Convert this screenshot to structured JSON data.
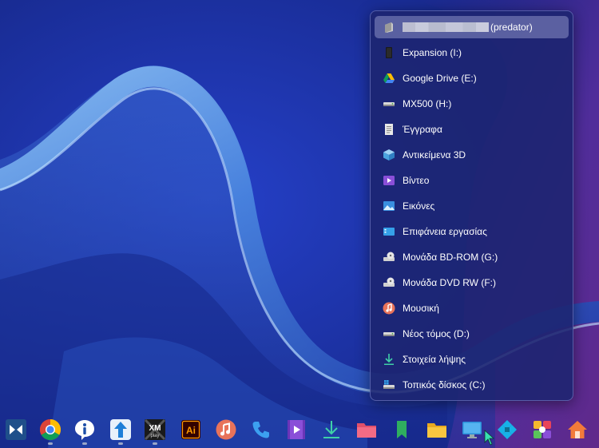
{
  "menu": {
    "items": [
      {
        "label": "(predator)",
        "icon": "user-folder-icon",
        "redacted": true,
        "selected": true
      },
      {
        "label": "Expansion (I:)",
        "icon": "external-drive-icon"
      },
      {
        "label": "Google Drive (E:)",
        "icon": "google-drive-icon"
      },
      {
        "label": "MX500 (H:)",
        "icon": "hard-drive-icon"
      },
      {
        "label": "Έγγραφα",
        "icon": "documents-icon"
      },
      {
        "label": "Αντικείμενα 3D",
        "icon": "3d-objects-icon"
      },
      {
        "label": "Βίντεο",
        "icon": "videos-icon"
      },
      {
        "label": "Εικόνες",
        "icon": "pictures-icon"
      },
      {
        "label": "Επιφάνεια εργασίας",
        "icon": "desktop-icon"
      },
      {
        "label": "Μονάδα BD-ROM (G:)",
        "icon": "optical-drive-icon"
      },
      {
        "label": "Μονάδα DVD RW (F:)",
        "icon": "optical-drive-icon"
      },
      {
        "label": "Μουσική",
        "icon": "music-icon"
      },
      {
        "label": "Νέος τόμος (D:)",
        "icon": "hard-drive-icon"
      },
      {
        "label": "Στοιχεία λήψης",
        "icon": "downloads-icon"
      },
      {
        "label": "Τοπικός δίσκος (C:)",
        "icon": "system-drive-icon"
      }
    ]
  },
  "taskbar": {
    "icons": [
      {
        "name": "dock-app-icon",
        "running": false
      },
      {
        "name": "chrome-icon",
        "running": true
      },
      {
        "name": "info-icon",
        "running": true
      },
      {
        "name": "upload-app-icon",
        "running": true
      },
      {
        "name": "xmplay-icon",
        "running": true
      },
      {
        "name": "illustrator-icon",
        "running": false
      },
      {
        "name": "music-player-icon",
        "running": false
      },
      {
        "name": "phone-icon",
        "running": false
      },
      {
        "name": "video-app-icon",
        "running": false
      },
      {
        "name": "download-icon",
        "running": false
      },
      {
        "name": "red-folder-icon",
        "running": false
      },
      {
        "name": "bookmark-icon",
        "running": false
      },
      {
        "name": "folder-icon",
        "running": false
      },
      {
        "name": "monitor-icon",
        "running": false
      },
      {
        "name": "kodi-icon",
        "running": false
      },
      {
        "name": "colorful-app-icon",
        "running": false
      },
      {
        "name": "home-icon",
        "running": false
      }
    ],
    "ai_label": "Ai",
    "xm_label": "XM",
    "xm_sub": "play"
  }
}
